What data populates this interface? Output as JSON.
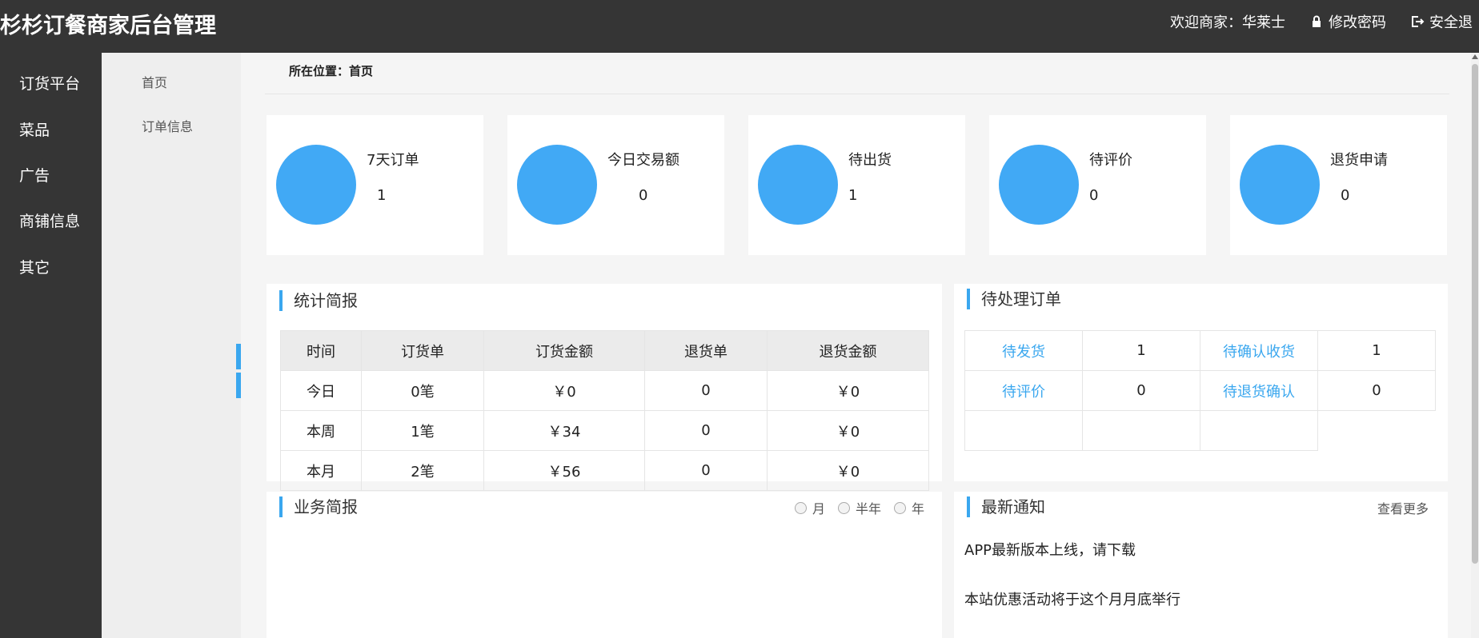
{
  "header": {
    "title": "杉杉订餐商家后台管理",
    "welcome": "欢迎商家：华莱士",
    "change_password": "修改密码",
    "logout": "安全退"
  },
  "leftnav": {
    "items": [
      {
        "label": "订货平台"
      },
      {
        "label": "菜品"
      },
      {
        "label": "广告"
      },
      {
        "label": "商铺信息"
      },
      {
        "label": "其它"
      }
    ]
  },
  "subnav": {
    "items": [
      {
        "label": "首页"
      },
      {
        "label": "订单信息"
      }
    ]
  },
  "breadcrumb": "所在位置：首页",
  "stats": [
    {
      "label": "7天订单",
      "value": "1"
    },
    {
      "label": "今日交易额",
      "value": "0"
    },
    {
      "label": "待出货",
      "value": "1"
    },
    {
      "label": "待评价",
      "value": "0"
    },
    {
      "label": "退货申请",
      "value": "0"
    }
  ],
  "report": {
    "title": "统计简报",
    "columns": [
      "时间",
      "订货单",
      "订货金额",
      "退货单",
      "退货金额"
    ],
    "rows": [
      [
        "今日",
        "0笔",
        "￥0",
        "0",
        "￥0"
      ],
      [
        "本周",
        "1笔",
        "￥34",
        "0",
        "￥0"
      ],
      [
        "本月",
        "2笔",
        "￥56",
        "0",
        "￥0"
      ]
    ]
  },
  "pending": {
    "title": "待处理订单",
    "rows": [
      [
        {
          "text": "待发货",
          "link": true
        },
        {
          "text": "1"
        },
        {
          "text": "待确认收货",
          "link": true
        },
        {
          "text": "1"
        }
      ],
      [
        {
          "text": "待评价",
          "link": true
        },
        {
          "text": "0"
        },
        {
          "text": "待退货确认",
          "link": true
        },
        {
          "text": "0"
        }
      ],
      [
        {
          "text": ""
        },
        {
          "text": ""
        },
        {
          "text": ""
        }
      ]
    ]
  },
  "business": {
    "title": "业务简报",
    "options": [
      "月",
      "半年",
      "年"
    ]
  },
  "notices": {
    "title": "最新通知",
    "more": "查看更多",
    "items": [
      "APP最新版本上线，请下载",
      "本站优惠活动将于这个月月底举行"
    ]
  },
  "colors": {
    "header_bg": "#353535",
    "accent": "#3aa7ef",
    "stat_circle": "#41a9f5"
  }
}
